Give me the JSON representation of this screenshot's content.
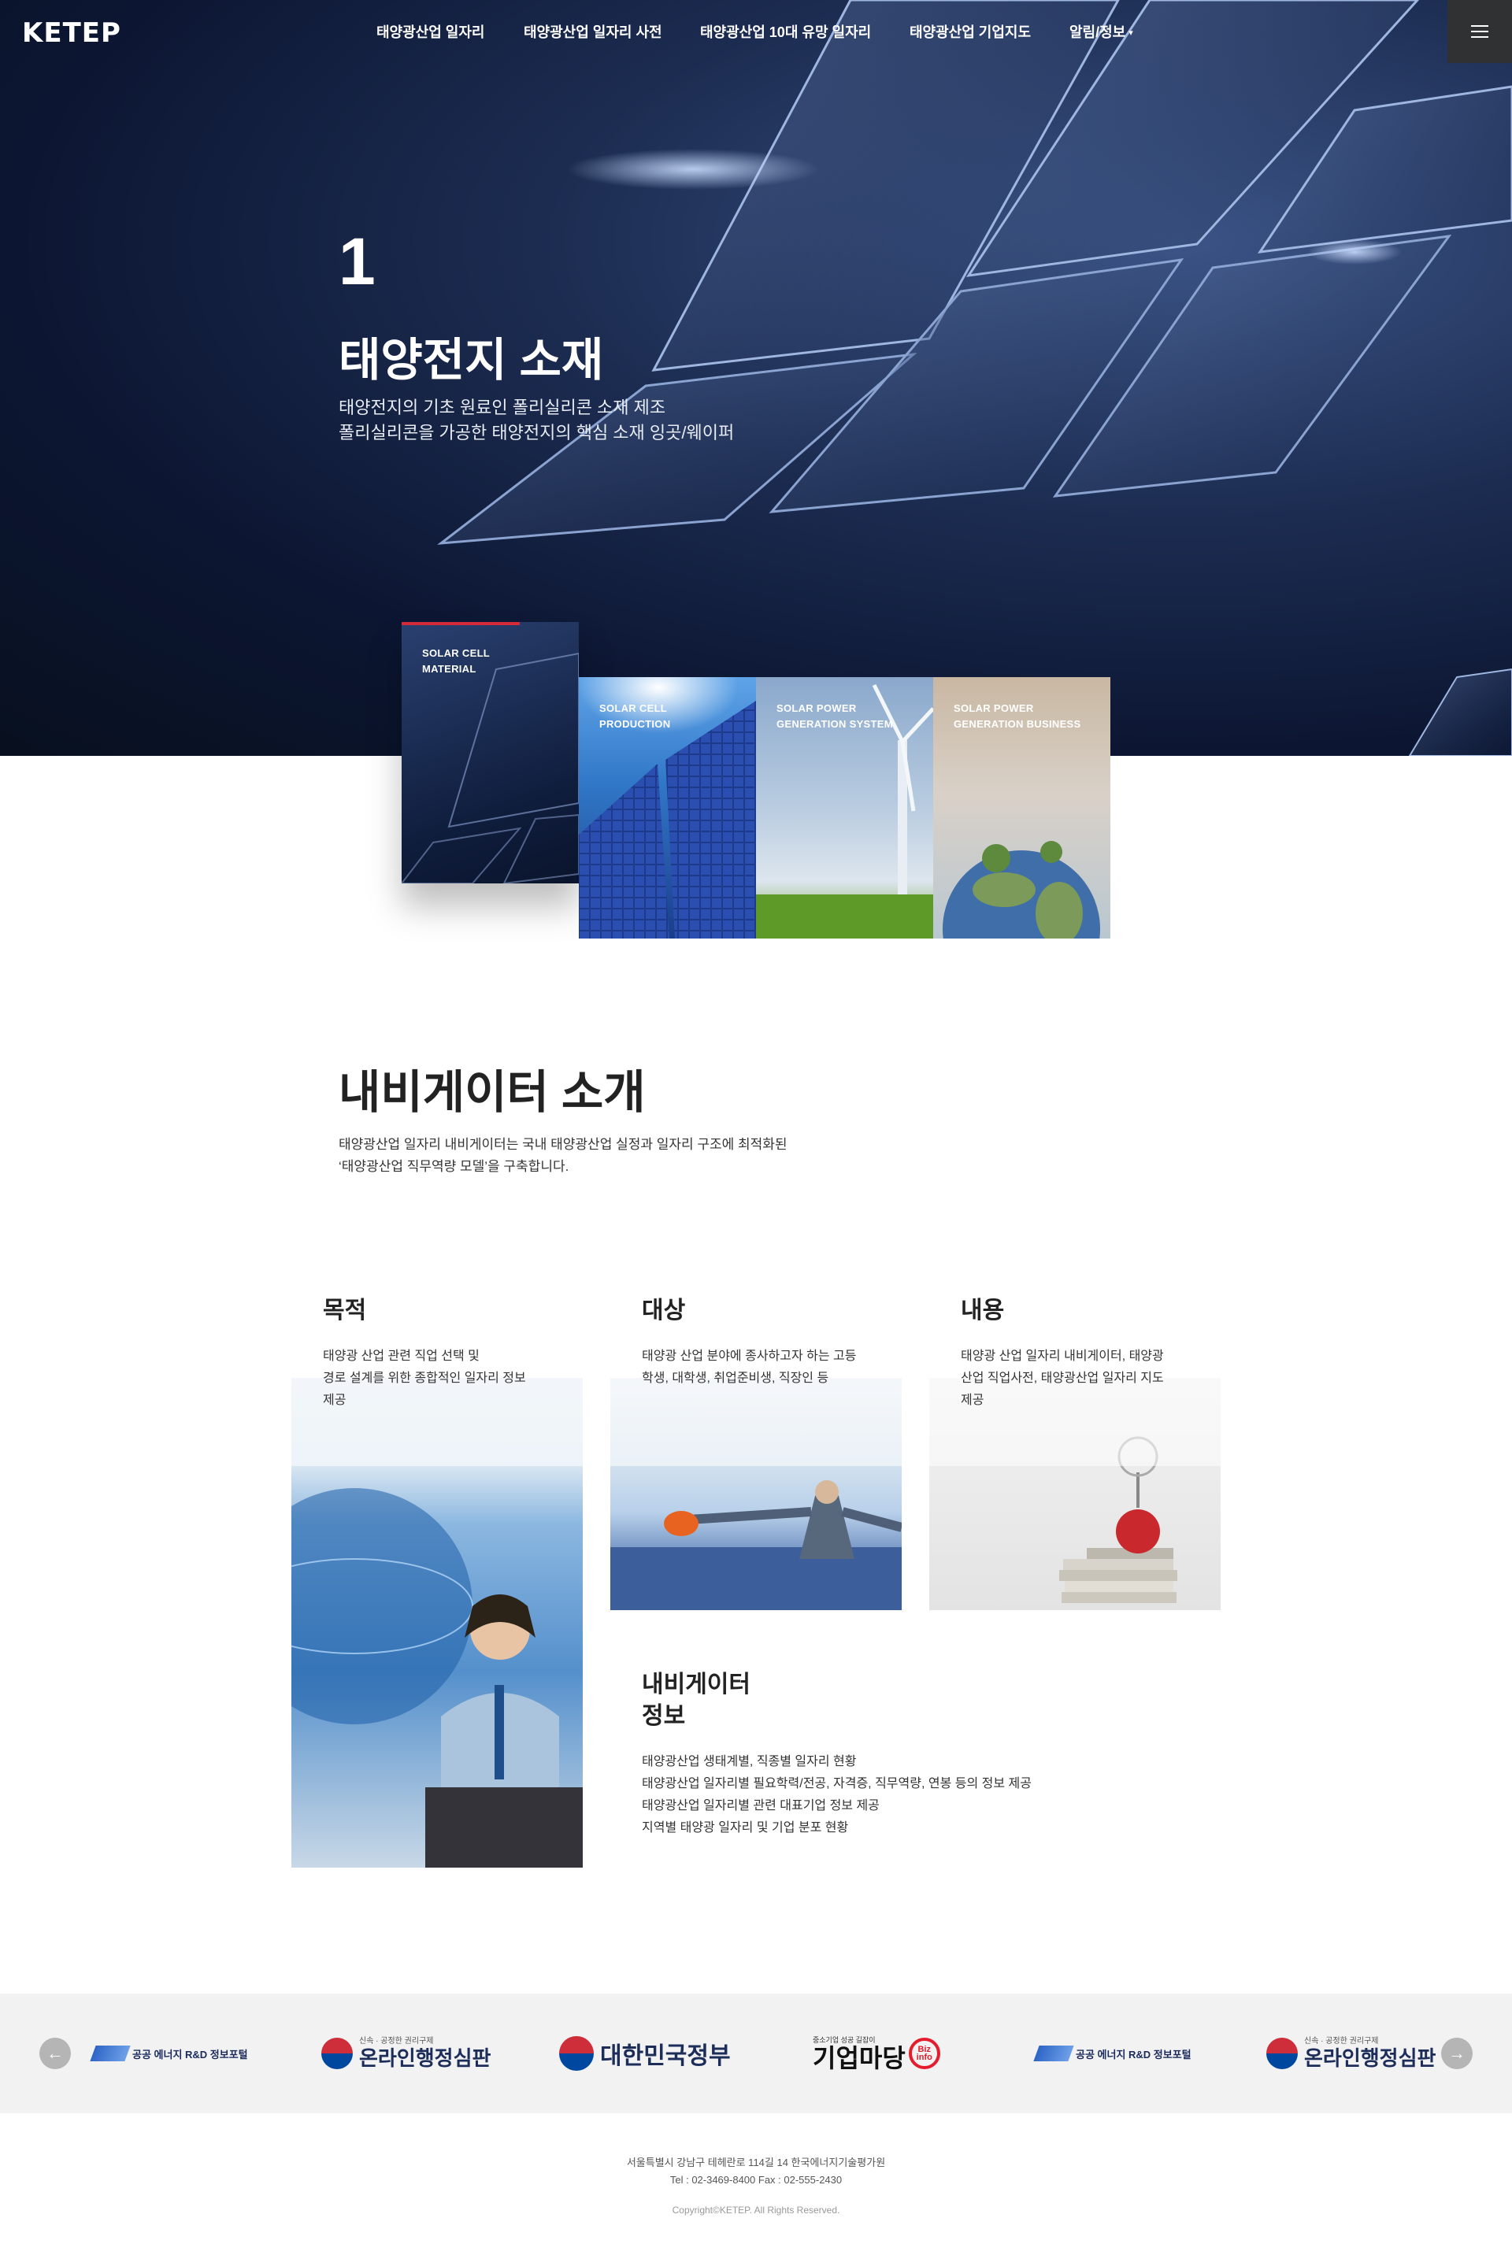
{
  "header": {
    "logo_text": "KETEP",
    "nav": [
      {
        "label": "태양광산업 일자리"
      },
      {
        "label": "태양광산업 일자리 사전"
      },
      {
        "label": "태양광산업 10대 유망 일자리"
      },
      {
        "label": "태양광산업 기업지도"
      },
      {
        "label": "알림/정보",
        "dropdown_caret": "▾"
      }
    ],
    "menu_icon": "hamburger-icon"
  },
  "hero": {
    "number": "1",
    "title": "태양전지 소재",
    "desc_lines": [
      "태양전지의 기초 원료인 폴리실리콘 소재 제조",
      "폴리실리콘을 가공한 태양전지의 핵심 소재 잉곳/웨이퍼"
    ]
  },
  "categories": [
    {
      "label_lines": [
        "SOLAR CELL",
        "MATERIAL"
      ],
      "active": true,
      "accent_color": "#d42a3a"
    },
    {
      "label_lines": [
        "SOLAR CELL",
        "PRODUCTION"
      ],
      "active": false
    },
    {
      "label_lines": [
        "SOLAR POWER",
        "GENERATION SYSTEM"
      ],
      "active": false
    },
    {
      "label_lines": [
        "SOLAR POWER",
        "GENERATION BUSINESS"
      ],
      "active": false
    }
  ],
  "intro": {
    "title": "내비게이터 소개",
    "desc_lines": [
      "태양광산업 일자리 내비게이터는 국내 태양광산업 실정과 일자리 구조에 최적화된",
      "‘태양광산업 직무역량 모델’을 구축합니다."
    ]
  },
  "info": {
    "purpose": {
      "title": "목적",
      "lines": [
        "태양광 산업 관련 직업 선택 및",
        "경로 설계를 위한 종합적인 일자리 정보",
        "제공"
      ]
    },
    "target": {
      "title": "대상",
      "lines": [
        "태양광 산업 분야에 종사하고자 하는 고등",
        "학생, 대학생, 취업준비생, 직장인 등"
      ]
    },
    "content": {
      "title": "내용",
      "lines": [
        "태양광 산업 일자리 내비게이터, 태양광",
        "산업 직업사전, 태양광산업 일자리 지도",
        "제공"
      ]
    },
    "navigator_info": {
      "title_lines": [
        "내비게이터",
        "정보"
      ],
      "lines": [
        "태양광산업 생태계별, 직종별 일자리 현황",
        "태양광산업 일자리별 필요학력/전공, 자격증, 직무역량, 연봉 등의 정보 제공",
        "태양광산업 일자리별 관련 대표기업 정보 제공",
        "지역별 태양광 일자리 및 기업 분포 현황"
      ]
    }
  },
  "partners": {
    "prev_icon": "arrow-left-icon",
    "next_icon": "arrow-right-icon",
    "items": [
      {
        "name": "공공 에너지 R&D 정보포털",
        "type": "rnd"
      },
      {
        "small": "신속 · 공정한 권리구제",
        "name": "온라인행정심판",
        "type": "online"
      },
      {
        "name": "대한민국정부",
        "type": "gov"
      },
      {
        "small": "중소기업 성공 길잡이",
        "name": "기업마당",
        "badge_lines": [
          "Biz",
          "info"
        ],
        "type": "biz"
      },
      {
        "name": "공공 에너지 R&D 정보포털",
        "type": "rnd"
      },
      {
        "small": "신속 · 공정한 권리구제",
        "name": "온라인행정심판",
        "type": "online"
      }
    ]
  },
  "footer": {
    "address": "서울특별시 강남구 테헤란로 114길 14 한국에너지기술평가원",
    "contact": "Tel : 02-3469-8400    Fax : 02-555-2430",
    "copyright": "Copyright©KETEP. All Rights Reserved."
  }
}
